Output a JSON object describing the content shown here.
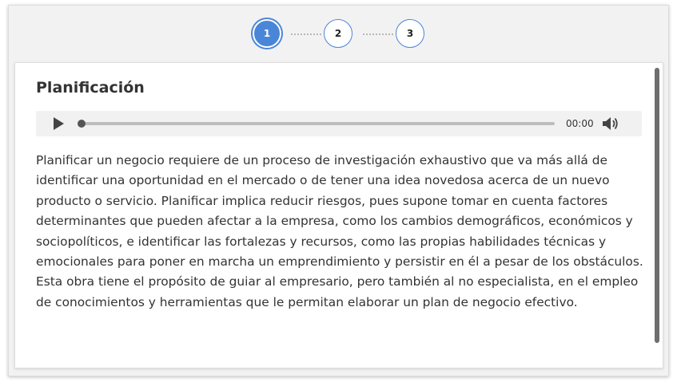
{
  "stepper": {
    "steps": [
      "1",
      "2",
      "3"
    ],
    "active_step": 1
  },
  "card": {
    "title": "Planificación",
    "audio": {
      "time": "00:00",
      "progress": 0,
      "play_icon": "play-icon",
      "volume_icon": "volume-icon"
    },
    "body": "Planificar un negocio requiere de un proceso de investigación exhaustivo que va más allá de identificar una oportunidad en el mercado o de tener una idea novedosa acerca de un nuevo producto o servicio. Planificar implica reducir riesgos, pues supone tomar en cuenta factores determinantes que pueden afectar a la empresa, como los cambios demográficos, económicos y sociopolíticos, e identificar las fortalezas y recursos, como las propias habilidades técnicas y emocionales para poner en marcha un emprendimiento y persistir en él a pesar de los obstáculos. Esta obra tiene el propósito de guiar al empresario, pero también al no especialista, en el empleo de conocimientos y herramientas que le permitan elaborar un plan de negocio efectivo."
  },
  "colors": {
    "accent": "#4a86d8",
    "panel_background": "#f2f2f2",
    "text": "#333333"
  }
}
